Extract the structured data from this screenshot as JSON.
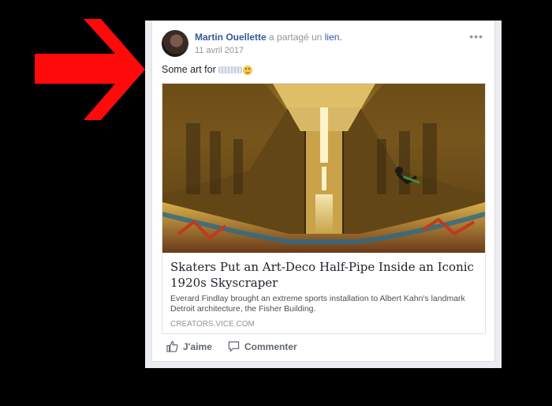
{
  "post": {
    "author": "Martin Ouellette",
    "action_text": "a partagé un",
    "action_link": "lien.",
    "date": "11 avril 2017",
    "more_label": "•••",
    "message": "Some art for"
  },
  "link_share": {
    "title": "Skaters Put an Art-Deco Half-Pipe Inside an Iconic 1920s Skyscraper",
    "description": "Everard Findlay brought an extreme sports installation to Albert Kahn's landmark Detroit architecture, the Fisher Building.",
    "domain": "CREATORS.VICE.COM"
  },
  "actions": {
    "like_label": "J'aime",
    "comment_label": "Commenter"
  },
  "icons": {
    "arrow": "red-arrow-icon",
    "more": "more-options-icon",
    "like": "thumbs-up-icon",
    "comment": "comment-bubble-icon",
    "emoji": "smiley-emoji-icon"
  },
  "colors": {
    "author_link": "#365899",
    "arrow": "#ff0a0a",
    "background": "#000000"
  }
}
